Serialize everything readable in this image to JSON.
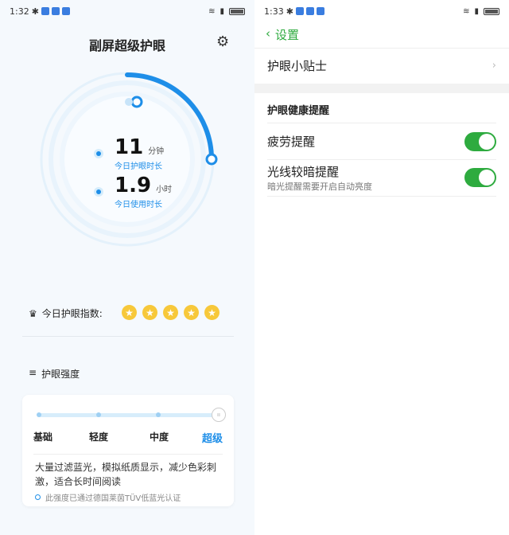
{
  "left": {
    "status": {
      "time": "1:32"
    },
    "title": "副屏超级护眼",
    "stats": [
      {
        "value": "11",
        "unit": "分钟",
        "label": "今日护眼时长"
      },
      {
        "value": "1.9",
        "unit": "小时",
        "label": "今日使用时长"
      }
    ],
    "ring_progress": 0.25,
    "index_label": "今日护眼指数:",
    "stars": 5,
    "strength_label": "护眼强度",
    "levels": [
      "基础",
      "轻度",
      "中度",
      "超级"
    ],
    "selected_level": 3,
    "description": "大量过滤蓝光，模拟纸质显示，减少色彩刺激，适合长时间阅读",
    "cert": "此强度已通过德国莱茵TÜV低蓝光认证"
  },
  "right": {
    "status": {
      "time": "1:33"
    },
    "back_label": "设置",
    "tips": "护眼小贴士",
    "section": "护眼健康提醒",
    "fatigue": {
      "label": "疲劳提醒",
      "on": true
    },
    "dim": {
      "label": "光线较暗提醒",
      "sub": "暗光提醒需要开启自动亮度",
      "on": true
    }
  }
}
